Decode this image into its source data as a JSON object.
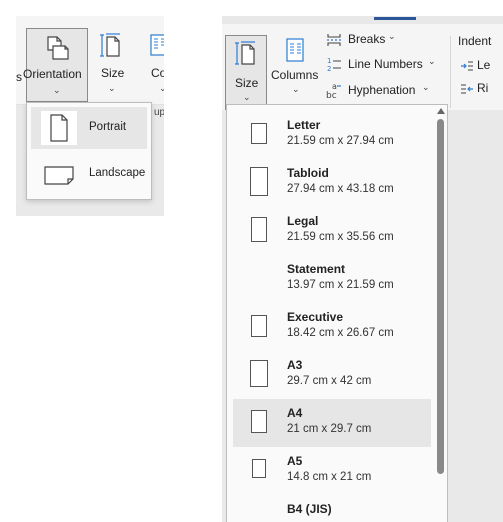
{
  "left_panel": {
    "ribbon": {
      "cut_label_prefix": "s",
      "orientation_label": "Orientation",
      "size_label": "Size",
      "columns_label": "Colu",
      "group_label_fragment": "up"
    },
    "orientation_menu": {
      "items": [
        {
          "label": "Portrait",
          "selected": true
        },
        {
          "label": "Landscape",
          "selected": false
        }
      ]
    }
  },
  "right_panel": {
    "ribbon": {
      "size_label": "Size",
      "columns_label": "Columns",
      "breaks_label": "Breaks",
      "line_numbers_label": "Line Numbers",
      "hyphenation_label": "Hyphenation",
      "indent_label": "Indent",
      "indent_left_fragment": "Le",
      "indent_right_fragment": "Ri"
    },
    "size_menu": {
      "items": [
        {
          "name": "Letter",
          "dims": "21.59 cm x 27.94 cm",
          "icon": true,
          "selected": false
        },
        {
          "name": "Tabloid",
          "dims": "27.94 cm x 43.18 cm",
          "icon": true,
          "selected": false
        },
        {
          "name": "Legal",
          "dims": "21.59 cm x 35.56 cm",
          "icon": true,
          "selected": false
        },
        {
          "name": "Statement",
          "dims": "13.97 cm x 21.59 cm",
          "icon": false,
          "selected": false
        },
        {
          "name": "Executive",
          "dims": "18.42 cm x 26.67 cm",
          "icon": true,
          "selected": false
        },
        {
          "name": "A3",
          "dims": "29.7 cm x 42 cm",
          "icon": true,
          "selected": false
        },
        {
          "name": "A4",
          "dims": "21 cm x 29.7 cm",
          "icon": true,
          "selected": true
        },
        {
          "name": "A5",
          "dims": "14.8 cm x 21 cm",
          "icon": true,
          "selected": false
        },
        {
          "name": "B4 (JIS)",
          "dims": "",
          "icon": false,
          "selected": false
        }
      ]
    }
  }
}
